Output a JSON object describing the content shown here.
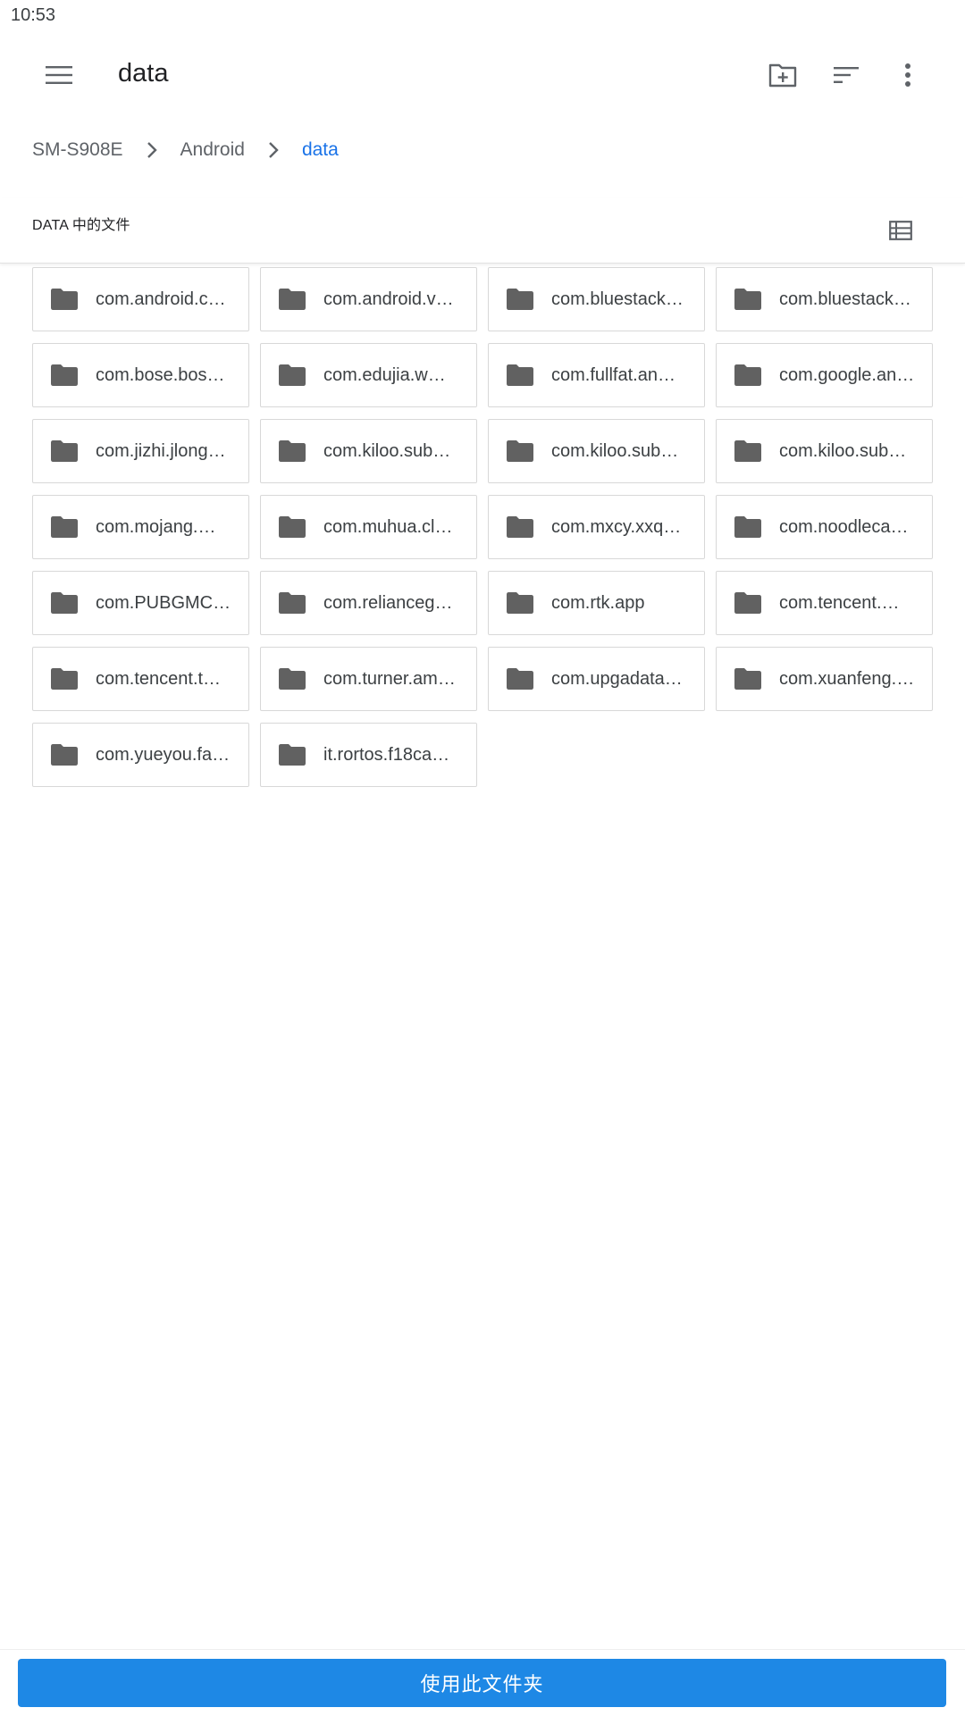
{
  "status_bar": {
    "time": "10:53"
  },
  "toolbar": {
    "title": "data",
    "icons": [
      "menu-icon",
      "create-new-folder-icon",
      "sort-icon",
      "more-vert-icon"
    ]
  },
  "breadcrumb": {
    "items": [
      "SM-S908E",
      "Android",
      "data"
    ]
  },
  "section": {
    "title": "DATA 中的文件",
    "view_icon": "list-view-icon"
  },
  "folders": [
    "com.android.c…",
    "com.android.v…",
    "com.bluestack…",
    "com.bluestack…",
    "com.bose.bos…",
    "com.edujia.w…",
    "com.fullfat.an…",
    "com.google.an…",
    "com.jizhi.jlong…",
    "com.kiloo.sub…",
    "com.kiloo.sub…",
    "com.kiloo.sub…",
    "com.mojang.…",
    "com.muhua.cl…",
    "com.mxcy.xxq…",
    "com.noodleca…",
    "com.PUBGMC…",
    "com.relianceg…",
    "com.rtk.app",
    "com.tencent.…",
    "com.tencent.t…",
    "com.turner.am…",
    "com.upgadata…",
    "com.xuanfeng.…",
    "com.yueyou.fa…",
    "it.rortos.f18ca…"
  ],
  "bottom": {
    "use_folder_label": "使用此文件夹"
  },
  "colors": {
    "accent": "#1e88e5",
    "active_crumb": "#1a73e8",
    "icon_gray": "#616161"
  }
}
